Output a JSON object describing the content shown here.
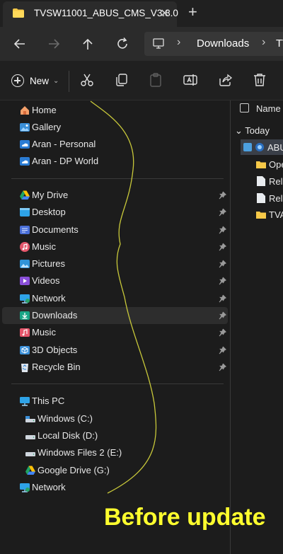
{
  "tab": {
    "title": "TVSW11001_ABUS_CMS_V3.8.0",
    "close": "✕",
    "new_tab": "+"
  },
  "address": {
    "crumb_1": "Downloads",
    "crumb_2": "TV",
    "separator": "›"
  },
  "command_bar": {
    "new_label": "New",
    "new_dropdown": "⌄"
  },
  "sidebar": {
    "group_top": [
      {
        "label": "Home",
        "icon": "home-icon"
      },
      {
        "label": "Gallery",
        "icon": "gallery-icon"
      },
      {
        "label": "Aran - Personal",
        "icon": "onedrive-icon"
      },
      {
        "label": "Aran - DP World",
        "icon": "onedrive-icon"
      }
    ],
    "group_pinned": [
      {
        "label": "My Drive",
        "icon": "google-drive-icon"
      },
      {
        "label": "Desktop",
        "icon": "desktop-icon"
      },
      {
        "label": "Documents",
        "icon": "documents-icon"
      },
      {
        "label": "Music",
        "icon": "music-icon"
      },
      {
        "label": "Pictures",
        "icon": "pictures-icon"
      },
      {
        "label": "Videos",
        "icon": "videos-icon"
      },
      {
        "label": "Network",
        "icon": "network-icon"
      },
      {
        "label": "Downloads",
        "icon": "downloads-icon"
      },
      {
        "label": "Music",
        "icon": "music-icon"
      },
      {
        "label": "3D Objects",
        "icon": "3d-objects-icon"
      },
      {
        "label": "Recycle Bin",
        "icon": "recycle-bin-icon"
      }
    ],
    "group_pc": [
      {
        "label": "This PC",
        "icon": "this-pc-icon"
      },
      {
        "label": "Windows (C:)",
        "icon": "drive-icon"
      },
      {
        "label": "Local Disk (D:)",
        "icon": "drive-icon"
      },
      {
        "label": "Windows Files 2 (E:)",
        "icon": "drive-icon"
      },
      {
        "label": "Google Drive (G:)",
        "icon": "google-drive-icon"
      },
      {
        "label": "Network",
        "icon": "network-icon"
      }
    ]
  },
  "file_pane": {
    "column_name": "Name",
    "group_label": "Today",
    "group_chevron": "⌄",
    "files": [
      {
        "name": "ABUS",
        "icon": "app-icon"
      },
      {
        "name": "Ope",
        "icon": "folder-icon"
      },
      {
        "name": "Rele",
        "icon": "file-icon"
      },
      {
        "name": "Rele",
        "icon": "file-icon"
      },
      {
        "name": "TVA",
        "icon": "folder-icon"
      }
    ]
  },
  "caption": "Before update",
  "colors": {
    "background": "#1c1c1c",
    "caption": "#ffff2e",
    "annotation_line": "#c8c83a",
    "accent": "#4ca0e0"
  }
}
